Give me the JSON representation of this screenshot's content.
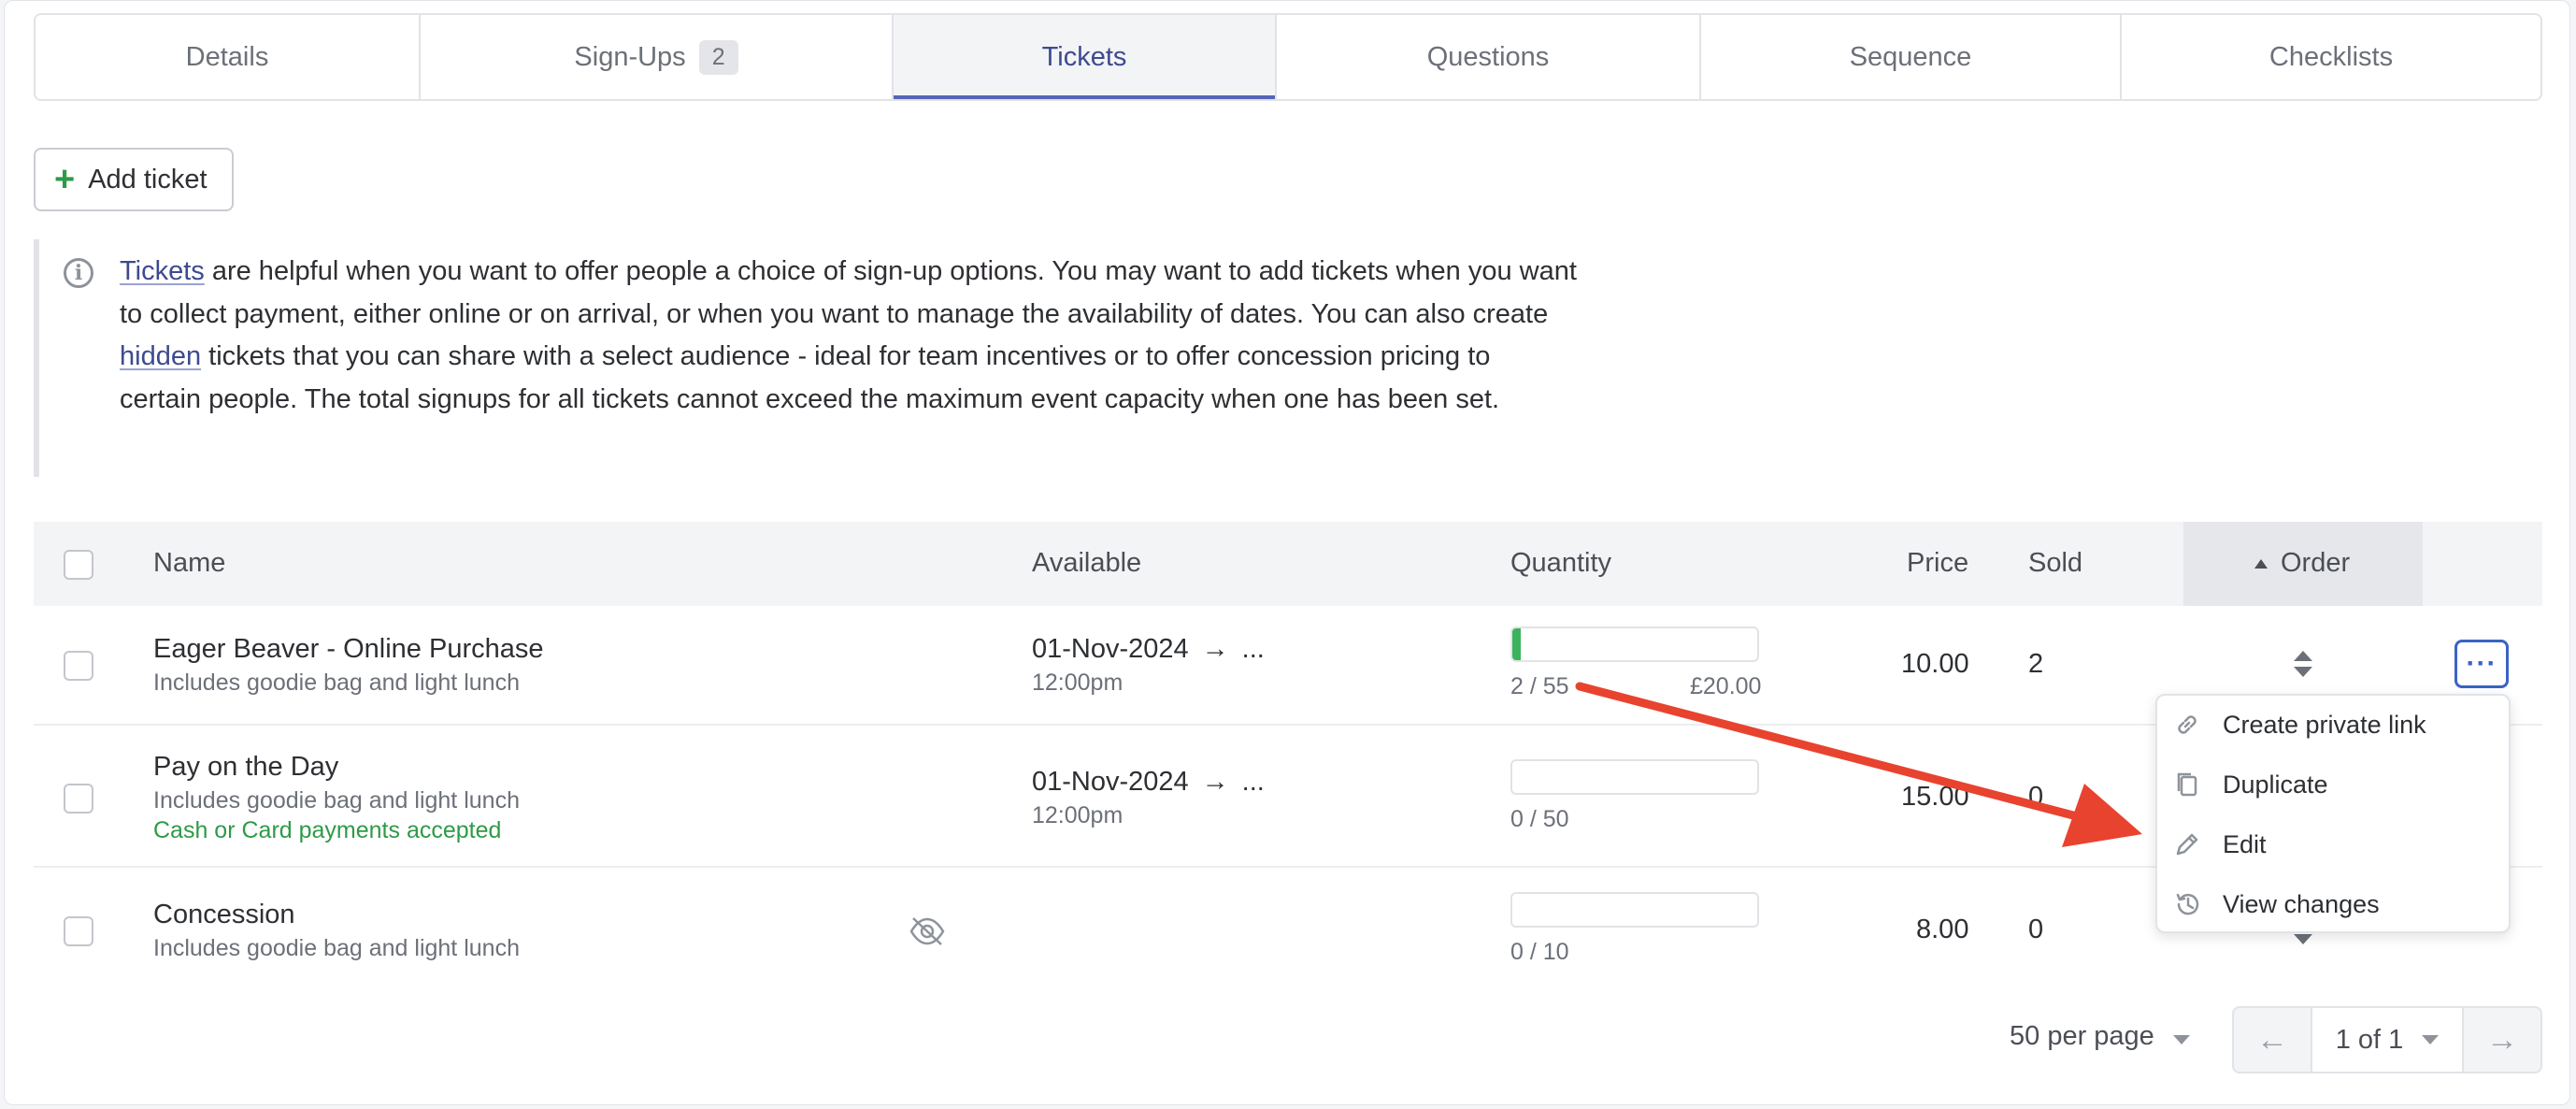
{
  "tabs": [
    {
      "label": "Details"
    },
    {
      "label": "Sign-Ups",
      "badge": "2"
    },
    {
      "label": "Tickets",
      "active": true
    },
    {
      "label": "Questions"
    },
    {
      "label": "Sequence"
    },
    {
      "label": "Checklists"
    }
  ],
  "add_ticket_label": "Add ticket",
  "info": {
    "t1": "Tickets",
    "t2": " are helpful when you want to offer people a choice of sign-up options. You may want to add tickets when you want to collect payment, either online or on arrival, or when you want to manage the availability of dates. You can also create ",
    "t3": "hidden",
    "t4": " tickets that you can share with a select audience - ideal for team incentives or to offer concession pricing to certain people. The total signups for all tickets cannot exceed the maximum event capacity when one has been set."
  },
  "table": {
    "headers": {
      "name": "Name",
      "available": "Available",
      "quantity": "Quantity",
      "price": "Price",
      "sold": "Sold",
      "order": "Order"
    },
    "rows": [
      {
        "name": "Eager Beaver - Online Purchase",
        "desc": "Includes goodie bag and light lunch",
        "date": "01-Nov-2024",
        "arrow": "→",
        "ellipsis": "...",
        "time": "12:00pm",
        "qty": "2 / 55",
        "qty_fraction": 0.036,
        "qty_price": "£20.00",
        "price": "10.00",
        "sold": "2"
      },
      {
        "name": "Pay on the Day",
        "desc": "Includes goodie bag and light lunch",
        "note": "Cash or Card payments accepted",
        "date": "01-Nov-2024",
        "arrow": "→",
        "ellipsis": "...",
        "time": "12:00pm",
        "qty": "0 / 50",
        "qty_fraction": 0,
        "price": "15.00",
        "sold": "0"
      },
      {
        "name": "Concession",
        "desc": "Includes goodie bag and light lunch",
        "hidden_icon": "eye-slash-icon",
        "qty": "0 / 10",
        "qty_fraction": 0,
        "price": "8.00",
        "sold": "0"
      }
    ]
  },
  "menu": [
    {
      "label": "Create private link",
      "icon": "link-icon"
    },
    {
      "label": "Duplicate",
      "icon": "copy-icon"
    },
    {
      "label": "Edit",
      "icon": "pencil-icon"
    },
    {
      "label": "View changes",
      "icon": "history-icon"
    }
  ],
  "more_label": "···",
  "pagination": {
    "per_page": "50 per page",
    "page": "1 of 1",
    "prev": "←",
    "next": "→"
  },
  "colors": {
    "accent": "#5565b8",
    "success": "#3bb35c",
    "annotation_arrow": "#e8432f"
  }
}
